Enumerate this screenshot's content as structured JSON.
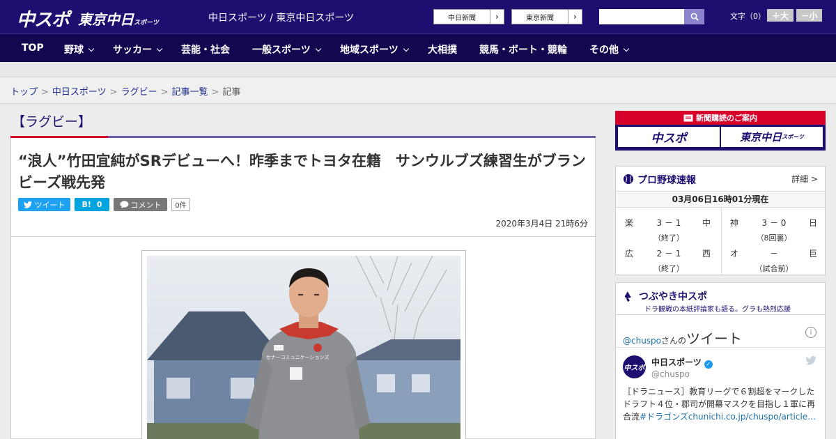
{
  "header": {
    "logo_main": "中スポ",
    "logo_tokyo": "東京中日",
    "logo_tokyo_small": "スポーツ",
    "tagline": "中日スポーツ / 東京中日スポーツ",
    "ext_links": [
      "中日新聞",
      "東京新聞"
    ],
    "search_placeholder": "",
    "font_size_label": "文字（0）",
    "font_plus": "＋大",
    "font_minus": "－小"
  },
  "nav": {
    "items": [
      {
        "label": "TOP",
        "dropdown": false
      },
      {
        "label": "野球",
        "dropdown": true
      },
      {
        "label": "サッカー",
        "dropdown": true
      },
      {
        "label": "芸能・社会",
        "dropdown": false
      },
      {
        "label": "一般スポーツ",
        "dropdown": true
      },
      {
        "label": "地域スポーツ",
        "dropdown": true
      },
      {
        "label": "大相撲",
        "dropdown": false
      },
      {
        "label": "競馬・ボート・競輪",
        "dropdown": false
      },
      {
        "label": "その他",
        "dropdown": true
      }
    ]
  },
  "breadcrumb": {
    "items": [
      "トップ",
      "中日スポーツ",
      "ラグビー",
      "記事一覧"
    ],
    "current": "記事",
    "separator": ">"
  },
  "article": {
    "category": "【ラグビー】",
    "title": "“浪人”竹田宜純がSRデビューへ！昨季までトヨタ在籍　サンウルブズ練習生がブランビーズ戦先発",
    "share": {
      "tweet_label": "ツイート",
      "hatena_label": "B!",
      "hatena_count": "0",
      "comment_label": "コメント",
      "comment_count": "0件"
    },
    "date": "2020年3月4日 21時6分",
    "photo_jersey_text": "セナーコミュニケーションズ"
  },
  "sidebar": {
    "subscription": {
      "header": "新聞購読のご案内",
      "logo1": "中スポ",
      "logo2": "東京中日",
      "logo2_small": "スポーツ"
    },
    "scores": {
      "title": "プロ野球速報",
      "detail_link": "詳細 >",
      "updated": "03月06日16時01分現在",
      "games": [
        {
          "home": "楽",
          "score": "3 － 1",
          "away": "中",
          "status": "（終了）"
        },
        {
          "home": "神",
          "score": "3 － 0",
          "away": "日",
          "status": "（8回裏）"
        },
        {
          "home": "広",
          "score": "2 － 1",
          "away": "西",
          "status": "（終了）"
        },
        {
          "home": "オ",
          "score": "－",
          "away": "巨",
          "status": "（試合前）"
        }
      ]
    },
    "tweets": {
      "title": "つぶやき中スポ",
      "subtitle": "ドラ観戦の本紙評論家も語る。グラも熱烈応援",
      "handle": "@chuspo",
      "handle_suffix": "さんの",
      "timeline_label": "ツイート",
      "info_icon": "i",
      "account_name": "中日スポーツ",
      "account_id": "@chuspo",
      "avatar_text": "中スポ",
      "tweet_text": "［ドラニュース］教育リーグで６割超をマークしたドラフト４位・郡司が開幕マスクを目指し１軍に再合流",
      "tweet_link": "#ドラゴンズchunichi.co.jp/chuspo/article…"
    }
  },
  "colors": {
    "header_bg": "#1d0e70",
    "nav_bg": "#14074f",
    "accent_red": "#d6002a",
    "tweet_blue": "#1da1f2",
    "hatena_blue": "#00a4de",
    "comment_gray": "#777777"
  }
}
